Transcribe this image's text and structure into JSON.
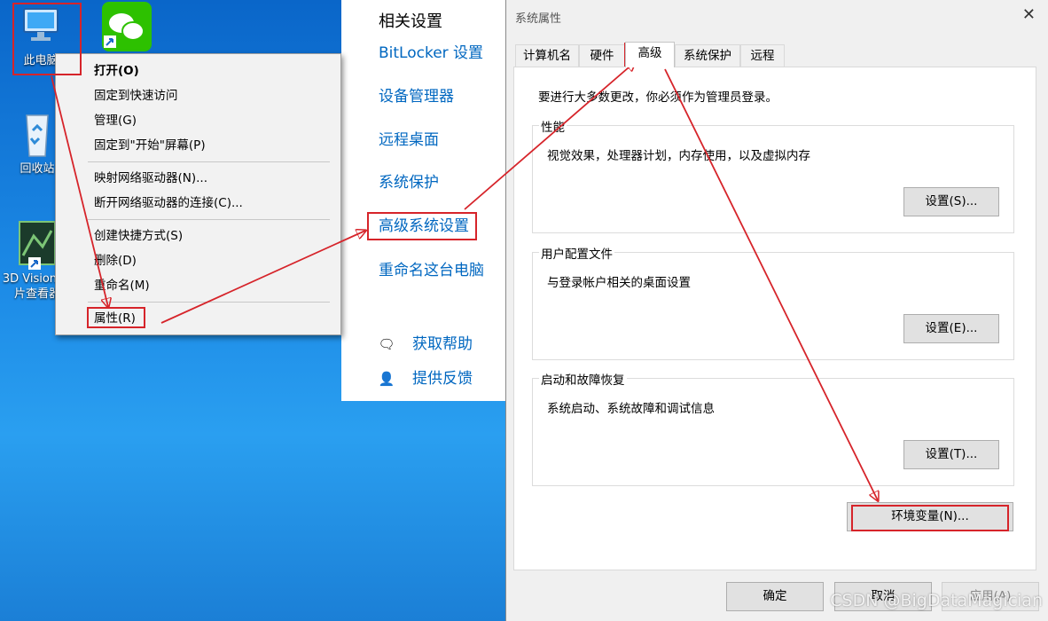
{
  "desktop": {
    "icons": {
      "this_pc": "此电脑",
      "recycle_bin": "回收站",
      "viewer": "3D Vision 照片查看器"
    }
  },
  "settings": {
    "heading": "相关设置",
    "links": [
      "BitLocker 设置",
      "设备管理器",
      "远程桌面",
      "系统保护",
      "高级系统设置",
      "重命名这台电脑"
    ],
    "help": "获取帮助",
    "feedback": "提供反馈"
  },
  "context_menu": {
    "items": [
      "打开(O)",
      "固定到快速访问",
      "管理(G)",
      "固定到\"开始\"屏幕(P)",
      "映射网络驱动器(N)...",
      "断开网络驱动器的连接(C)...",
      "创建快捷方式(S)",
      "删除(D)",
      "重命名(M)",
      "属性(R)"
    ]
  },
  "dialog": {
    "title": "系统属性",
    "tabs": [
      "计算机名",
      "硬件",
      "高级",
      "系统保护",
      "远程"
    ],
    "active_tab": "高级",
    "intro": "要进行大多数更改，你必须作为管理员登录。",
    "groups": [
      {
        "title": "性能",
        "desc": "视觉效果，处理器计划，内存使用，以及虚拟内存",
        "button": "设置(S)..."
      },
      {
        "title": "用户配置文件",
        "desc": "与登录帐户相关的桌面设置",
        "button": "设置(E)..."
      },
      {
        "title": "启动和故障恢复",
        "desc": "系统启动、系统故障和调试信息",
        "button": "设置(T)..."
      }
    ],
    "env_button": "环境变量(N)...",
    "ok": "确定",
    "cancel": "取消",
    "apply": "应用(A)"
  },
  "watermark": "CSDN @BigDataMagician",
  "colors": {
    "highlight": "#d6242a",
    "link": "#0067c0",
    "desktop": "#1c8ae6"
  }
}
